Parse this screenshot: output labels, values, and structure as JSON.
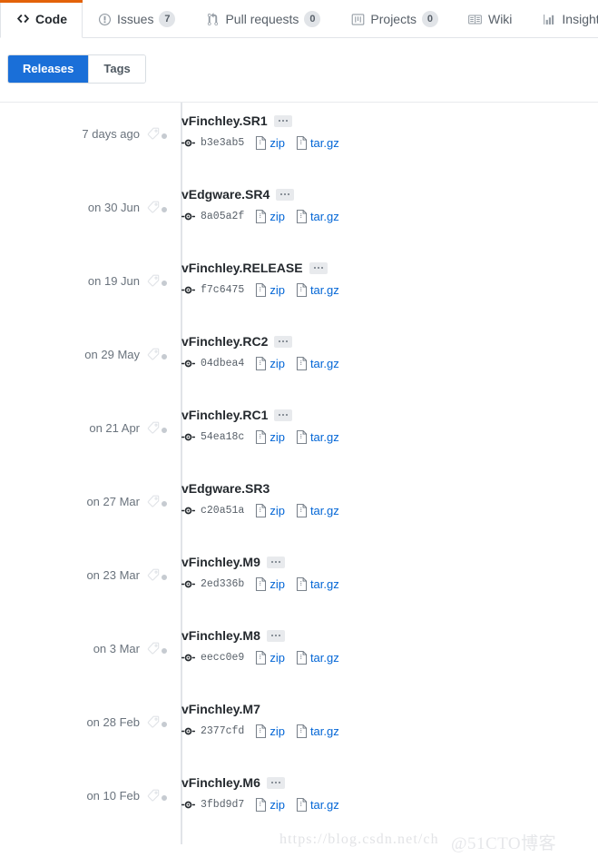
{
  "repo_nav": {
    "tabs": [
      {
        "label": "Code",
        "icon": "code-icon",
        "count": null,
        "selected": true
      },
      {
        "label": "Issues",
        "icon": "issue-opened-icon",
        "count": "7",
        "selected": false
      },
      {
        "label": "Pull requests",
        "icon": "git-pull-request-icon",
        "count": "0",
        "selected": false
      },
      {
        "label": "Projects",
        "icon": "project-icon",
        "count": "0",
        "selected": false
      },
      {
        "label": "Wiki",
        "icon": "book-icon",
        "count": null,
        "selected": false
      },
      {
        "label": "Insights",
        "icon": "graph-icon",
        "count": null,
        "selected": false
      }
    ],
    "active_tab_accent": "#e36209"
  },
  "subnav": {
    "releases_label": "Releases",
    "tags_label": "Tags",
    "active": "Releases",
    "active_color": "#1a6fd8"
  },
  "releases": [
    {
      "date": "7 days ago",
      "name": "vFinchley.SR1",
      "has_menu": true,
      "commit": "b3e3ab5",
      "zip_label": "zip",
      "targz_label": "tar.gz"
    },
    {
      "date": "on 30 Jun",
      "name": "vEdgware.SR4",
      "has_menu": true,
      "commit": "8a05a2f",
      "zip_label": "zip",
      "targz_label": "tar.gz"
    },
    {
      "date": "on 19 Jun",
      "name": "vFinchley.RELEASE",
      "has_menu": true,
      "commit": "f7c6475",
      "zip_label": "zip",
      "targz_label": "tar.gz"
    },
    {
      "date": "on 29 May",
      "name": "vFinchley.RC2",
      "has_menu": true,
      "commit": "04dbea4",
      "zip_label": "zip",
      "targz_label": "tar.gz"
    },
    {
      "date": "on 21 Apr",
      "name": "vFinchley.RC1",
      "has_menu": true,
      "commit": "54ea18c",
      "zip_label": "zip",
      "targz_label": "tar.gz"
    },
    {
      "date": "on 27 Mar",
      "name": "vEdgware.SR3",
      "has_menu": false,
      "commit": "c20a51a",
      "zip_label": "zip",
      "targz_label": "tar.gz"
    },
    {
      "date": "on 23 Mar",
      "name": "vFinchley.M9",
      "has_menu": true,
      "commit": "2ed336b",
      "zip_label": "zip",
      "targz_label": "tar.gz"
    },
    {
      "date": "on 3 Mar",
      "name": "vFinchley.M8",
      "has_menu": true,
      "commit": "eecc0e9",
      "zip_label": "zip",
      "targz_label": "tar.gz"
    },
    {
      "date": "on 28 Feb",
      "name": "vFinchley.M7",
      "has_menu": false,
      "commit": "2377cfd",
      "zip_label": "zip",
      "targz_label": "tar.gz"
    },
    {
      "date": "on 10 Feb",
      "name": "vFinchley.M6",
      "has_menu": true,
      "commit": "3fbd9d7",
      "zip_label": "zip",
      "targz_label": "tar.gz"
    }
  ],
  "watermarks": {
    "url": "https://blog.csdn.net/ch",
    "site": "@51CTO博客"
  }
}
